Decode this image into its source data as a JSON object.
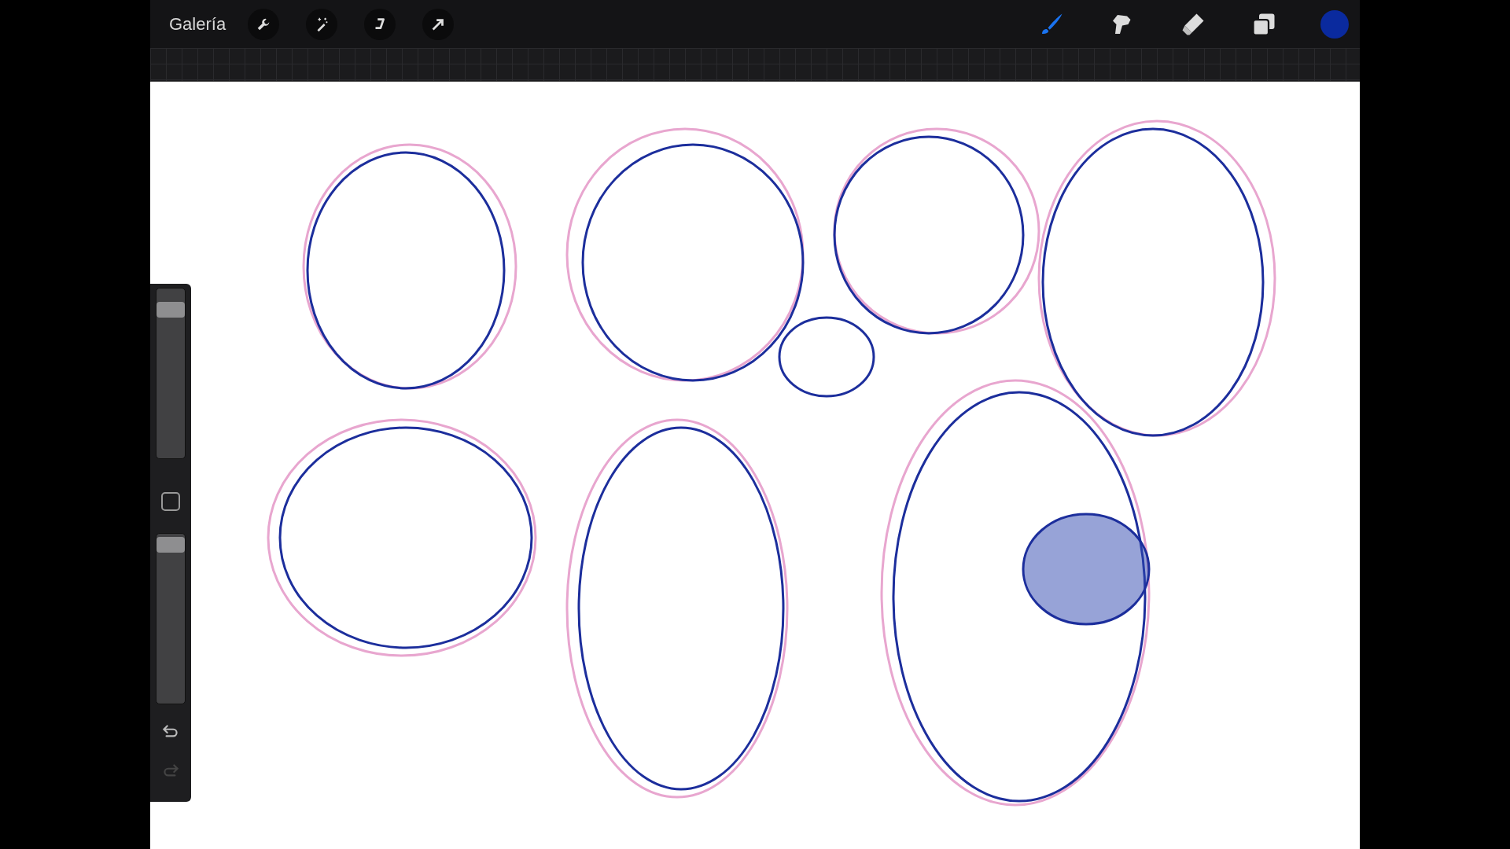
{
  "toolbar": {
    "gallery_label": "Galería",
    "left_tools": [
      {
        "kind": "wrench"
      },
      {
        "kind": "wand"
      },
      {
        "kind": "selection"
      },
      {
        "kind": "transform"
      }
    ],
    "right_tools": [
      {
        "kind": "brush",
        "selected": true
      },
      {
        "kind": "smudge",
        "selected": false
      },
      {
        "kind": "eraser",
        "selected": false
      },
      {
        "kind": "layers",
        "selected": false
      }
    ],
    "color_swatch": {
      "color": "#0a2a9e"
    }
  },
  "sidebar": {
    "size_slider": {
      "level": 0.92
    },
    "opacity_slider": {
      "level": 0.98
    },
    "undo": {
      "disabled": false
    },
    "redo": {
      "disabled": true
    }
  }
}
